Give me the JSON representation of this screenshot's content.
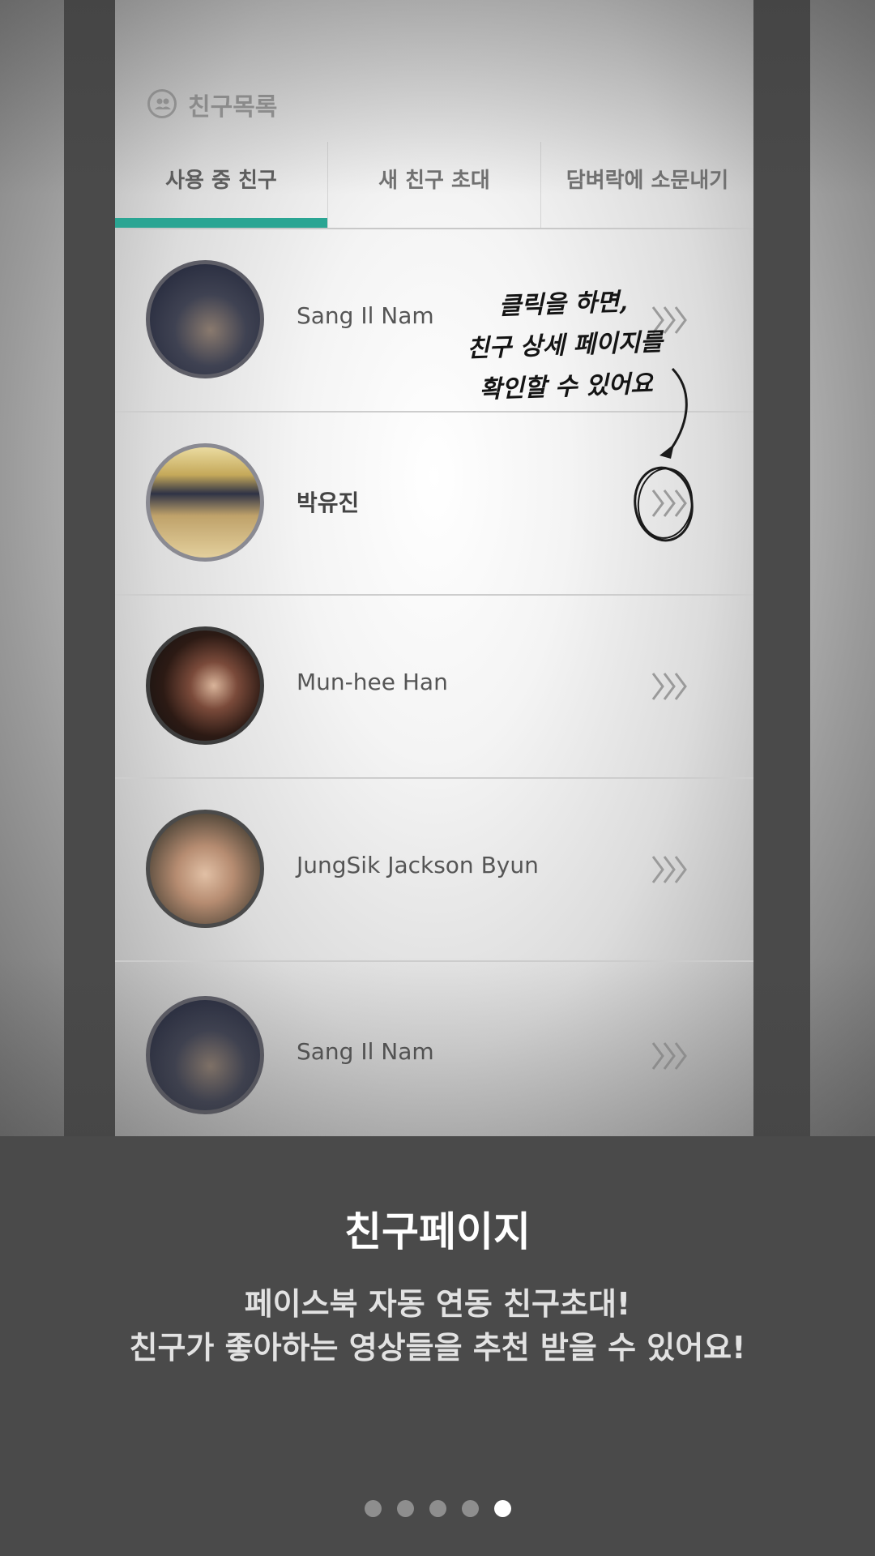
{
  "header": {
    "title": "친구목록",
    "icon": "friends-icon"
  },
  "tabs": [
    {
      "label": "사용 중 친구",
      "active": true
    },
    {
      "label": "새 친구 초대",
      "active": false
    },
    {
      "label": "담벼락에 소문내기",
      "active": false
    }
  ],
  "friends": [
    {
      "name": "Sang Il Nam"
    },
    {
      "name": "박유진"
    },
    {
      "name": "Mun-hee Han"
    },
    {
      "name": "JungSik Jackson Byun"
    },
    {
      "name": "Sang Il Nam"
    }
  ],
  "annotation": {
    "line1": "클릭을 하면,",
    "line2": "친구 상세 페이지를",
    "line3": "확인할 수 있어요"
  },
  "panel": {
    "title": "친구페이지",
    "line1": "페이스북 자동 연동 친구초대!",
    "line2": "친구가 좋아하는 영상들을 추천 받을 수 있어요!"
  },
  "pagination": {
    "total": 5,
    "current": 5
  },
  "colors": {
    "accent": "#2aa593",
    "panel": "#4a4a4a"
  }
}
